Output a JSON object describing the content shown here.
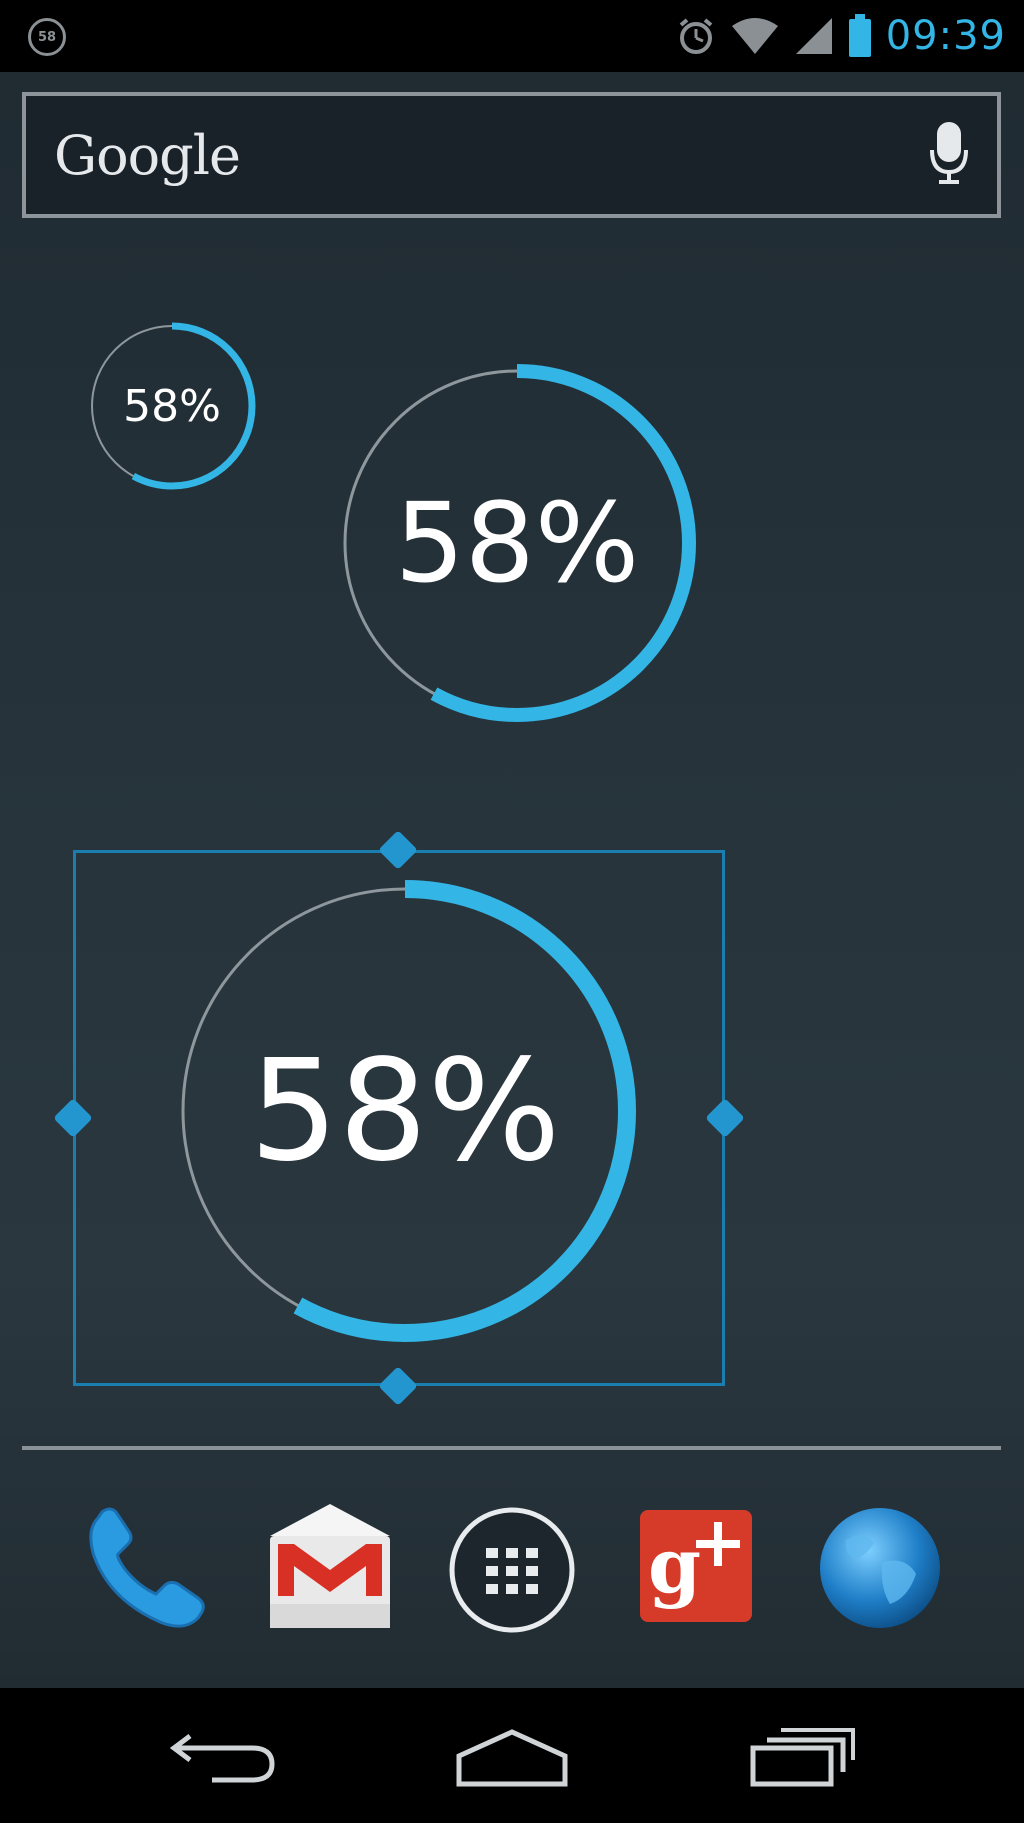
{
  "status_bar": {
    "left_icon": "58",
    "time": "09:39",
    "icons": [
      "alarm-icon",
      "wifi-icon",
      "signal-icon",
      "battery-icon"
    ]
  },
  "search_bar": {
    "logo_text": "Google",
    "mic_icon": "microphone-icon"
  },
  "widgets": [
    {
      "label": "58%",
      "percent": 58
    },
    {
      "label": "58%",
      "percent": 58
    },
    {
      "label": "58%",
      "percent": 58
    }
  ],
  "dock": {
    "items": [
      "phone-icon",
      "gmail-icon",
      "app-drawer-icon",
      "google-plus-icon",
      "browser-icon"
    ]
  },
  "nav_bar": {
    "buttons": [
      "back-icon",
      "home-icon",
      "recent-apps-icon"
    ]
  },
  "colors": {
    "accent": "#33b5e5",
    "ring_track": "#8e979c",
    "frame": "#1a7fb0"
  }
}
